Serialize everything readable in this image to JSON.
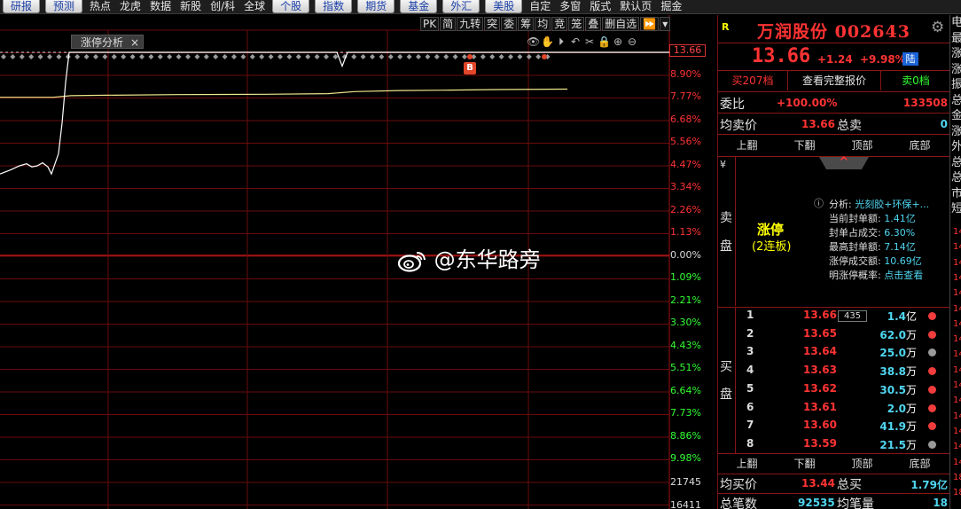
{
  "menu": [
    {
      "label": "研报",
      "button": true
    },
    {
      "label": "预测",
      "button": true
    },
    {
      "label": "热点",
      "button": false
    },
    {
      "label": "龙虎",
      "button": false
    },
    {
      "label": "数据",
      "button": false
    },
    {
      "label": "新股",
      "button": false
    },
    {
      "label": "创/科",
      "button": false
    },
    {
      "label": "全球",
      "button": false
    },
    {
      "label": "个股",
      "button": true
    },
    {
      "label": "指数",
      "button": true
    },
    {
      "label": "期货",
      "button": true
    },
    {
      "label": "基金",
      "button": true
    },
    {
      "label": "外汇",
      "button": true
    },
    {
      "label": "美股",
      "button": true
    },
    {
      "label": "自定",
      "button": false
    },
    {
      "label": "多窗",
      "button": false
    },
    {
      "label": "版式",
      "button": false
    },
    {
      "label": "默认页",
      "button": false
    },
    {
      "label": "掘金",
      "button": false
    }
  ],
  "chart_toolbar": [
    "PK",
    "简",
    "九转",
    "突",
    "委",
    "筹",
    "均",
    "竞",
    "笼",
    "叠",
    "删自选",
    "⏩",
    "▾"
  ],
  "chart_icons": [
    "👁",
    "✋",
    "⏵",
    "↶",
    "✂",
    "🔒",
    "⊕",
    "⊖"
  ],
  "tag": {
    "label": "涨停分析",
    "close": "×"
  },
  "price_flag": "13.66",
  "b_marker": "B",
  "watermark": "@东华路旁",
  "chart_data": {
    "type": "line",
    "right_axis_ticks": [
      "8.90%",
      "7.77%",
      "6.68%",
      "5.56%",
      "4.47%",
      "3.34%",
      "2.26%",
      "1.13%",
      "0.00%",
      "1.09%",
      "2.21%",
      "3.30%",
      "4.43%",
      "5.51%",
      "6.64%",
      "7.73%",
      "8.86%",
      "9.98%"
    ],
    "volume_ticks": [
      "21745",
      "16411"
    ],
    "price_series_pct": [
      [
        0,
        4.0
      ],
      [
        12,
        4.2
      ],
      [
        22,
        4.4
      ],
      [
        30,
        4.5
      ],
      [
        36,
        4.35
      ],
      [
        42,
        4.4
      ],
      [
        48,
        4.55
      ],
      [
        54,
        4.35
      ],
      [
        58,
        4.0
      ],
      [
        62,
        4.5
      ],
      [
        66,
        5.0
      ],
      [
        70,
        6.5
      ],
      [
        74,
        8.5
      ],
      [
        78,
        9.98
      ],
      [
        82,
        9.98
      ],
      [
        120,
        9.98
      ],
      [
        380,
        9.98
      ],
      [
        386,
        9.3
      ],
      [
        392,
        9.98
      ],
      [
        760,
        9.98
      ]
    ],
    "avg_series_pct": [
      [
        0,
        7.77
      ],
      [
        60,
        7.77
      ],
      [
        80,
        7.85
      ],
      [
        120,
        7.87
      ],
      [
        200,
        7.9
      ],
      [
        300,
        7.92
      ],
      [
        370,
        7.95
      ],
      [
        400,
        8.05
      ],
      [
        450,
        8.1
      ],
      [
        500,
        8.12
      ],
      [
        560,
        8.15
      ],
      [
        640,
        8.17
      ]
    ],
    "grid": true
  },
  "stock": {
    "badge": "R",
    "name": "万润股份 002643",
    "price": "13.66",
    "change": "+1.24",
    "change_pct": "+9.98%",
    "market": "陆"
  },
  "tabs": [
    "买207档",
    "查看完整报价",
    "卖0档"
  ],
  "weibi": {
    "label": "委比",
    "pct": "+100.00%",
    "diff": "133508"
  },
  "avg_sell": {
    "label": "均卖价",
    "value": "13.66",
    "label2": "总卖",
    "value2": "0"
  },
  "nav": [
    "上翻",
    "下翻",
    "顶部",
    "底部"
  ],
  "sell_side": {
    "yen": "¥",
    "c1": "卖",
    "c2": "盘",
    "caret": "^"
  },
  "limit": {
    "title": "涨停",
    "sub": "(2连板)",
    "info_icon": "ⓘ",
    "analysis_label": "分析:",
    "analysis_value": "光刻胶+环保+...",
    "lines": [
      {
        "label": "当前封单额:",
        "value": "1.41亿"
      },
      {
        "label": "封单占成交:",
        "value": "6.30%"
      },
      {
        "label": "最高封单额:",
        "value": "7.14亿"
      },
      {
        "label": "涨停成交额:",
        "value": "10.69亿"
      },
      {
        "label": "明涨停概率:",
        "value": "点击查看"
      }
    ]
  },
  "buy_side": {
    "c1": "买",
    "c2": "盘"
  },
  "book": [
    {
      "lvl": "1",
      "price": "13.66",
      "vol": "1.4",
      "unit": "亿",
      "dot": "#f03c3c"
    },
    {
      "lvl": "2",
      "price": "13.65",
      "vol": "62.0",
      "unit": "万",
      "dot": "#f03c3c"
    },
    {
      "lvl": "3",
      "price": "13.64",
      "vol": "25.0",
      "unit": "万",
      "dot": "#9a9a9a"
    },
    {
      "lvl": "4",
      "price": "13.63",
      "vol": "38.8",
      "unit": "万",
      "dot": "#f03c3c"
    },
    {
      "lvl": "5",
      "price": "13.62",
      "vol": "30.5",
      "unit": "万",
      "dot": "#f03c3c"
    },
    {
      "lvl": "6",
      "price": "13.61",
      "vol": "2.0",
      "unit": "万",
      "dot": "#f03c3c"
    },
    {
      "lvl": "7",
      "price": "13.60",
      "vol": "41.9",
      "unit": "万",
      "dot": "#f03c3c"
    },
    {
      "lvl": "8",
      "price": "13.59",
      "vol": "21.5",
      "unit": "万",
      "dot": "#9a9a9a"
    }
  ],
  "count_tag": "435",
  "avg_buy": {
    "label": "均买价",
    "value": "13.44",
    "label2": "总买",
    "value2": "1.79亿"
  },
  "total": {
    "label": "总笔数",
    "value": "92535",
    "label2": "均笔量",
    "value2": "18"
  },
  "strip": {
    "chars": [
      "电",
      "最",
      "涨",
      "涨",
      "振",
      "总",
      "金",
      "涨",
      "外",
      "总",
      "总",
      "市",
      "短"
    ],
    "nums": [
      "14",
      "14",
      "14",
      "14",
      "14",
      "14",
      "14",
      "14",
      "14",
      "14",
      "14",
      "14",
      "14",
      "14",
      "14",
      "14",
      "18",
      "18"
    ]
  },
  "colors": {
    "red": "#f33",
    "cyan": "#4fd6f0",
    "grid": "#7a0c0c",
    "yellow": "#ff0"
  }
}
